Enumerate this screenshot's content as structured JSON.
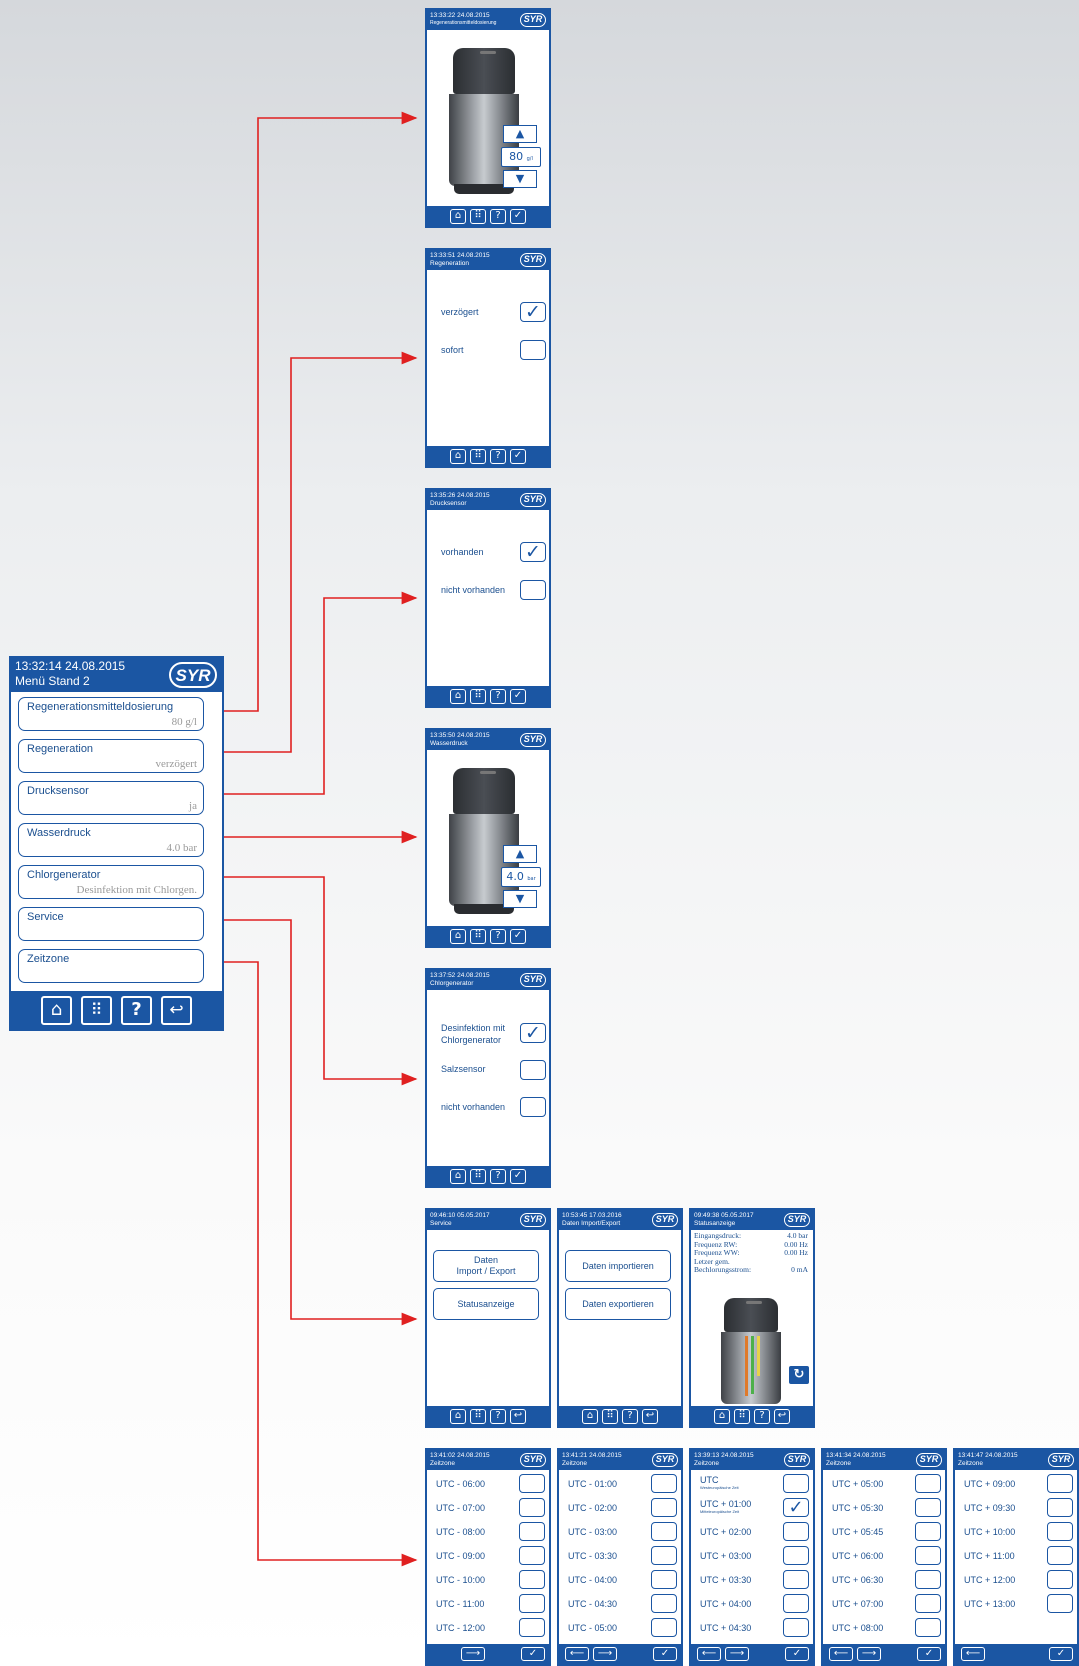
{
  "main_menu": {
    "time": "13:32:14 24.08.2015",
    "title": "Menü Stand 2",
    "logo": "SYR",
    "items": [
      {
        "label": "Regenerationsmitteldosierung",
        "value": "80 g/l"
      },
      {
        "label": "Regeneration",
        "value": "verzögert"
      },
      {
        "label": "Drucksensor",
        "value": "ja"
      },
      {
        "label": "Wasserdruck",
        "value": "4.0 bar"
      },
      {
        "label": "Chlorgenerator",
        "value": "Desinfektion mit Chlorgen."
      },
      {
        "label": "Service",
        "value": ""
      },
      {
        "label": "Zeitzone",
        "value": ""
      }
    ],
    "footer_icons": [
      "home-icon",
      "grid-icon",
      "help-icon",
      "back-icon"
    ]
  },
  "dosing": {
    "time": "13:33:22 24.08.2015",
    "title": "Regenerationsmitteldosierung",
    "value": "80",
    "unit": "g/l"
  },
  "regeneration": {
    "time": "13:33:51 24.08.2015",
    "title": "Regeneration",
    "options": [
      {
        "label": "verzögert",
        "checked": true
      },
      {
        "label": "sofort",
        "checked": false
      }
    ]
  },
  "pressure_sensor": {
    "time": "13:35:26 24.08.2015",
    "title": "Drucksensor",
    "options": [
      {
        "label": "vorhanden",
        "checked": true
      },
      {
        "label": "nicht vorhanden",
        "checked": false
      }
    ]
  },
  "water_pressure": {
    "time": "13:35:50 24.08.2015",
    "title": "Wasserdruck",
    "value": "4.0",
    "unit": "bar"
  },
  "chlorine": {
    "time": "13:37:52 24.08.2015",
    "title": "Chlorgenerator",
    "options": [
      {
        "label": "Desinfektion mit Chlorgenerator",
        "label_line1": "Desinfektion mit",
        "label_line2": "Chlorgenerator",
        "checked": true
      },
      {
        "label": "Salzsensor",
        "checked": false
      },
      {
        "label": "nicht vorhanden",
        "checked": false
      }
    ]
  },
  "service": {
    "time": "09:46:10 05.05.2017",
    "title": "Service",
    "button1_line1": "Daten",
    "button1_line2": "Import / Export",
    "button2": "Statusanzeige"
  },
  "data_io": {
    "time": "10:53:45 17.03.2016",
    "title": "Daten Import/Export",
    "button1": "Daten importieren",
    "button2": "Daten exportieren"
  },
  "status": {
    "time": "09:49:38 05.05.2017",
    "title": "Statusanzeige",
    "rows": [
      {
        "label": "Eingangsdruck:",
        "value": "4.0 bar"
      },
      {
        "label": "Frequenz RW:",
        "value": "0.00 Hz"
      },
      {
        "label": "Frequenz WW:",
        "value": "0.00 Hz"
      },
      {
        "label": "Letzer gem.",
        "value": ""
      },
      {
        "label": "Bechlorungsstrom:",
        "value": "0 mA"
      }
    ]
  },
  "timezones": [
    {
      "time": "13:41:02 24.08.2015",
      "title": "Zeitzone",
      "items": [
        "UTC - 06:00",
        "UTC - 07:00",
        "UTC - 08:00",
        "UTC - 09:00",
        "UTC - 10:00",
        "UTC - 11:00",
        "UTC - 12:00"
      ]
    },
    {
      "time": "13:41:21 24.08.2015",
      "title": "Zeitzone",
      "items": [
        "UTC - 01:00",
        "UTC - 02:00",
        "UTC - 03:00",
        "UTC - 03:30",
        "UTC - 04:00",
        "UTC - 04:30",
        "UTC - 05:00"
      ]
    },
    {
      "time": "13:39:13 24.08.2015",
      "title": "Zeitzone",
      "items": [
        "UTC",
        "UTC + 01:00",
        "UTC + 02:00",
        "UTC + 03:00",
        "UTC + 03:30",
        "UTC + 04:00",
        "UTC + 04:30"
      ],
      "subs": [
        "Westeuropäische Zeit",
        "Mitteleuropäische Zeit"
      ]
    },
    {
      "time": "13:41:34 24.08.2015",
      "title": "Zeitzone",
      "items": [
        "UTC + 05:00",
        "UTC + 05:30",
        "UTC + 05:45",
        "UTC + 06:00",
        "UTC + 06:30",
        "UTC + 07:00",
        "UTC + 08:00"
      ]
    },
    {
      "time": "13:41:47 24.08.2015",
      "title": "Zeitzone",
      "items": [
        "UTC + 09:00",
        "UTC + 09:30",
        "UTC + 10:00",
        "UTC + 11:00",
        "UTC + 12:00",
        "UTC + 13:00"
      ]
    }
  ],
  "colors": {
    "brand_blue": "#1b56a3",
    "arrow_red": "#e02020"
  }
}
